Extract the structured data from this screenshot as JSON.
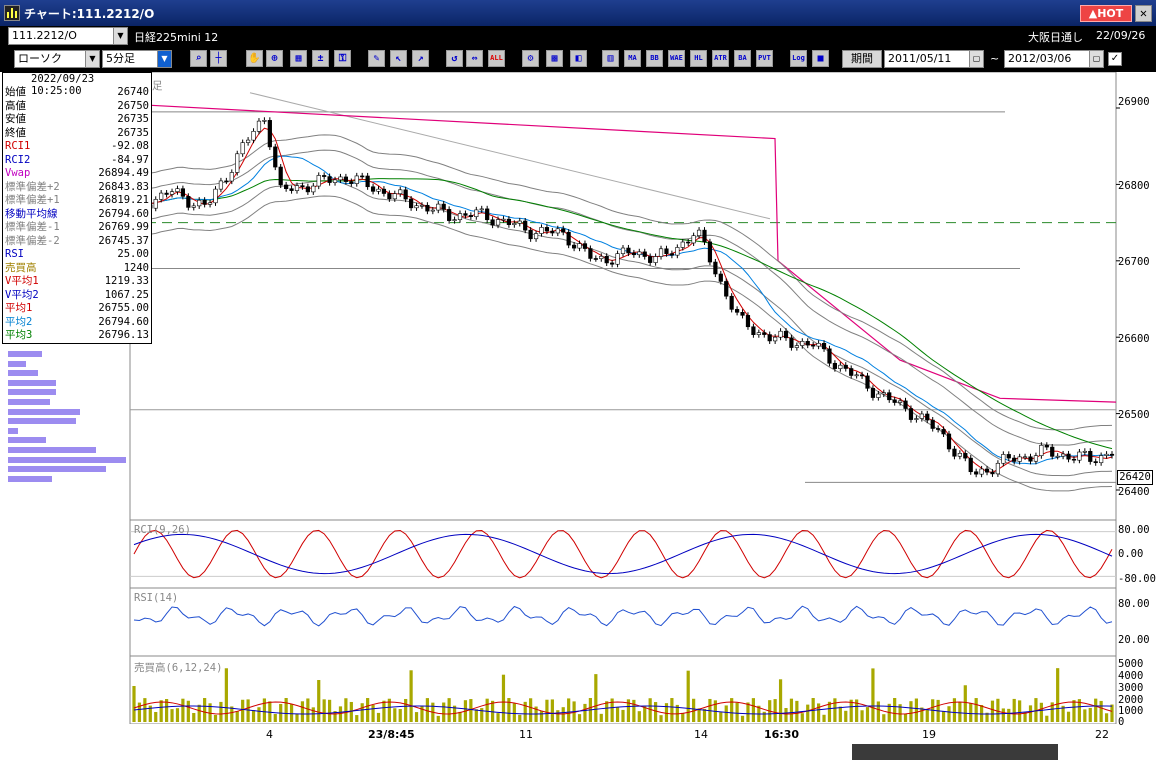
{
  "titlebar": {
    "title": "チャート:111.2212/O",
    "hot_label": "HOT",
    "close_label": "✕"
  },
  "toolbar1": {
    "symbol_value": "111.2212/O",
    "instrument_name": "日経225mini 12",
    "session_label": "大阪日通し",
    "date_label": "22/09/26"
  },
  "toolbar2": {
    "chart_type_value": "ローソク",
    "interval_value": "5分足",
    "period_label": "期間",
    "start_date": "2011/05/11",
    "tilde": "~",
    "end_date": "2012/03/06",
    "icons": [
      "search-icon",
      "crosshair-icon",
      "hand-icon",
      "zoom-icon",
      "grid-icon",
      "plus-minus-icon",
      "lock-icon",
      "pencil-icon",
      "cursor-icon",
      "arrow-icon",
      "reset-icon",
      "expand-icon",
      "all-icon",
      "gear-icon",
      "palette-icon",
      "color-icon",
      "bars-icon",
      "ma-icon",
      "bb-icon",
      "wae-icon",
      "hl-icon",
      "atr-icon",
      "ba-icon",
      "pvt-icon",
      "log-icon",
      "snapshot-icon"
    ],
    "icon_labels": {
      "all": "ALL",
      "ma": "MA",
      "bb": "BB",
      "wae": "WAE",
      "hl": "HL",
      "atr": "ATR",
      "ba": "BA",
      "pvt": "PVT",
      "log": "Log"
    }
  },
  "info_panel": {
    "datetime": "2022/09/23  10:25:00",
    "rows": [
      {
        "k": "始値",
        "v": "26740",
        "color": "#000000"
      },
      {
        "k": "高値",
        "v": "26750",
        "color": "#000000"
      },
      {
        "k": "安値",
        "v": "26735",
        "color": "#000000"
      },
      {
        "k": "終値",
        "v": "26735",
        "color": "#000000"
      },
      {
        "k": "RCI1",
        "v": "-92.08",
        "color": "#d00000"
      },
      {
        "k": "RCI2",
        "v": "-84.97",
        "color": "#0000c0"
      },
      {
        "k": "Vwap",
        "v": "26894.49",
        "color": "#c000c0"
      },
      {
        "k": "標準偏差+2",
        "v": "26843.83",
        "color": "#808080"
      },
      {
        "k": "標準偏差+1",
        "v": "26819.21",
        "color": "#808080"
      },
      {
        "k": "移動平均線",
        "v": "26794.60",
        "color": "#0000c0"
      },
      {
        "k": "標準偏差-1",
        "v": "26769.99",
        "color": "#808080"
      },
      {
        "k": "標準偏差-2",
        "v": "26745.37",
        "color": "#808080"
      },
      {
        "k": "RSI",
        "v": "25.00",
        "color": "#0000c0"
      },
      {
        "k": "売買高",
        "v": "1240",
        "color": "#a08000"
      },
      {
        "k": "V平均1",
        "v": "1219.33",
        "color": "#d00000"
      },
      {
        "k": "V平均2",
        "v": "1067.25",
        "color": "#0000c0"
      },
      {
        "k": "平均1",
        "v": "26755.00",
        "color": "#d00000"
      },
      {
        "k": "平均2",
        "v": "26794.60",
        "color": "#0080d0"
      },
      {
        "k": "平均3",
        "v": "26796.13",
        "color": "#008000"
      }
    ]
  },
  "main_chart": {
    "price_axis": [
      "26900",
      "26800",
      "26700",
      "26600",
      "26500",
      "26400"
    ],
    "current_price": "26420",
    "panel_label_fragment": "足"
  },
  "rci_panel": {
    "label": "RCI(9,26)",
    "axis": [
      "80.00",
      "0.00",
      "-80.00"
    ]
  },
  "rsi_panel": {
    "label": "RSI(14)",
    "axis": [
      "80.00",
      "20.00"
    ]
  },
  "volume_panel": {
    "label": "売買高(6,12,24)",
    "axis": [
      "5000",
      "4000",
      "3000",
      "2000",
      "1000",
      "0"
    ]
  },
  "x_axis": [
    "4",
    "23/8:45",
    "11",
    "14",
    "16:30",
    "19",
    "22"
  ],
  "colors": {
    "candle_up": "#ffffff",
    "candle_down": "#000000",
    "rci1": "#d00000",
    "rci2": "#0000c0",
    "vwap": "#e0007a",
    "ma1": "#d00000",
    "ma2": "#0080e0",
    "ma3": "#008000",
    "bands": "#808080",
    "rsi": "#2050d0",
    "volume": "#a8a800"
  }
}
